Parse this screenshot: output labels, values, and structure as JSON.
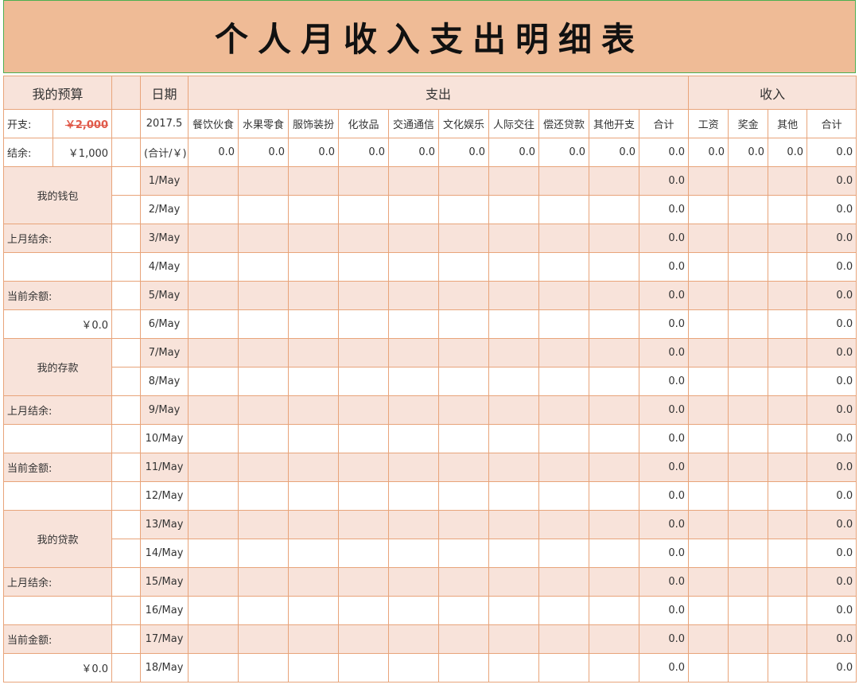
{
  "title": "个人月收入支出明细表",
  "budget": {
    "header": "我的预算",
    "spend_label": "开支:",
    "spend_value": "￥2,000",
    "balance_label": "结余:",
    "balance_value": "￥1,000"
  },
  "date_header": "日期",
  "period": "2017.5",
  "period_total_label": "(合计/￥)",
  "expense_header": "支出",
  "income_header": "收入",
  "expense_categories": [
    "餐饮伙食",
    "水果零食",
    "服饰装扮",
    "化妆品",
    "交通通信",
    "文化娱乐",
    "人际交往",
    "偿还贷款",
    "其他开支",
    "合计"
  ],
  "income_categories": [
    "工资",
    "奖金",
    "其他",
    "合计"
  ],
  "expense_totals": [
    "0.0",
    "0.0",
    "0.0",
    "0.0",
    "0.0",
    "0.0",
    "0.0",
    "0.0",
    "0.0",
    "0.0"
  ],
  "income_totals": [
    "0.0",
    "0.0",
    "0.0",
    "0.0"
  ],
  "left_panel": {
    "wallet_title": "我的钱包",
    "wallet_last_label": "上月结余:",
    "wallet_current_label": "当前余额:",
    "wallet_current_value": "￥0.0",
    "savings_title": "我的存款",
    "savings_last_label": "上月结余:",
    "savings_current_label": "当前金额:",
    "loan_title": "我的贷款",
    "loan_last_label": "上月结余:",
    "loan_current_label": "当前金额:",
    "loan_current_value": "￥0.0"
  },
  "days": [
    {
      "date": "1/May",
      "expense_total": "0.0",
      "income_total": "0.0"
    },
    {
      "date": "2/May",
      "expense_total": "0.0",
      "income_total": "0.0"
    },
    {
      "date": "3/May",
      "expense_total": "0.0",
      "income_total": "0.0"
    },
    {
      "date": "4/May",
      "expense_total": "0.0",
      "income_total": "0.0"
    },
    {
      "date": "5/May",
      "expense_total": "0.0",
      "income_total": "0.0"
    },
    {
      "date": "6/May",
      "expense_total": "0.0",
      "income_total": "0.0"
    },
    {
      "date": "7/May",
      "expense_total": "0.0",
      "income_total": "0.0"
    },
    {
      "date": "8/May",
      "expense_total": "0.0",
      "income_total": "0.0"
    },
    {
      "date": "9/May",
      "expense_total": "0.0",
      "income_total": "0.0"
    },
    {
      "date": "10/May",
      "expense_total": "0.0",
      "income_total": "0.0"
    },
    {
      "date": "11/May",
      "expense_total": "0.0",
      "income_total": "0.0"
    },
    {
      "date": "12/May",
      "expense_total": "0.0",
      "income_total": "0.0"
    },
    {
      "date": "13/May",
      "expense_total": "0.0",
      "income_total": "0.0"
    },
    {
      "date": "14/May",
      "expense_total": "0.0",
      "income_total": "0.0"
    },
    {
      "date": "15/May",
      "expense_total": "0.0",
      "income_total": "0.0"
    },
    {
      "date": "16/May",
      "expense_total": "0.0",
      "income_total": "0.0"
    },
    {
      "date": "17/May",
      "expense_total": "0.0",
      "income_total": "0.0"
    },
    {
      "date": "18/May",
      "expense_total": "0.0",
      "income_total": "0.0"
    }
  ]
}
